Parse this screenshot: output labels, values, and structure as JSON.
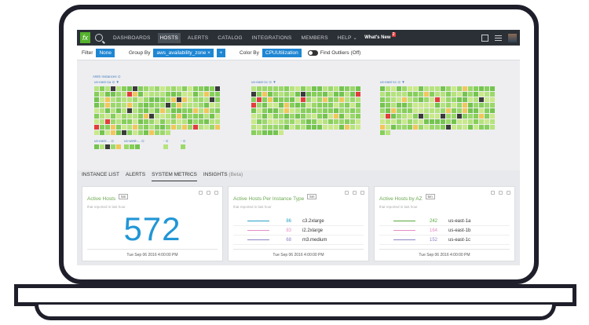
{
  "nav": {
    "logo": "fx",
    "items": [
      "DASHBOARDS",
      "HOSTS",
      "ALERTS",
      "CATALOG",
      "INTEGRATIONS",
      "MEMBERS",
      "HELP ⌄"
    ],
    "whats_new": "What's New",
    "whats_new_badge": "2"
  },
  "filterbar": {
    "filter_label": "Filter",
    "filter_value": "None",
    "group_label": "Group By",
    "group_value": "aws_availability_zone ×",
    "add_label": "+",
    "color_label": "Color By",
    "color_value": "CPUUtilization",
    "outliers_label": "Find Outliers (Off)"
  },
  "map": {
    "root_label": "AWS Instances ⊙",
    "zones": [
      {
        "label": "us-east-1a ⊙ ▼"
      },
      {
        "label": "us-east-1c ⊙ ▼"
      },
      {
        "label": "us-east-1c ⊙ ▼"
      }
    ],
    "small_groups": [
      "us-east-... ⊙",
      "us-west-... ⊙",
      "- ⊙",
      "- ⊙"
    ]
  },
  "tabs": [
    {
      "label": "INSTANCE LIST"
    },
    {
      "label": "ALERTS"
    },
    {
      "label": "SYSTEM METRICS"
    },
    {
      "label": "INSIGHTS",
      "sub": "(Beta)"
    }
  ],
  "cards": [
    {
      "title": "Active Hosts",
      "pill": "5m",
      "subtitle": "that reported in last hour",
      "value": "572",
      "date": "Tue Sep 06 2016 4:00:00 PM"
    },
    {
      "title": "Active Hosts Per Instance Type",
      "pill": "5m",
      "subtitle": "that reported in last hour",
      "rows": [
        {
          "value": "86",
          "name": "c3.2xlarge",
          "color": "#2aa1c6"
        },
        {
          "value": "83",
          "name": "i2.2xlarge",
          "color": "#e58fc7"
        },
        {
          "value": "68",
          "name": "m3.medium",
          "color": "#8a84c8"
        }
      ],
      "date": "Tue Sep 06 2016 4:00:00 PM"
    },
    {
      "title": "Active Hosts by AZ",
      "pill": "5m",
      "subtitle": "that reported in last hour",
      "rows": [
        {
          "value": "242",
          "name": "us-east-1a",
          "color": "#58a83b"
        },
        {
          "value": "164",
          "name": "us-east-1b",
          "color": "#e58fc7"
        },
        {
          "value": "152",
          "name": "us-east-1c",
          "color": "#8a84c8"
        }
      ],
      "date": "Tue Sep 06 2016 4:00:00 PM"
    }
  ],
  "colors": {
    "accent": "#1e86d3",
    "nav_bg": "#2b3036",
    "ok": "#9bd86a",
    "warn": "#f0c75a",
    "hot": "#e23d3d",
    "dark": "#3a3a3a"
  }
}
